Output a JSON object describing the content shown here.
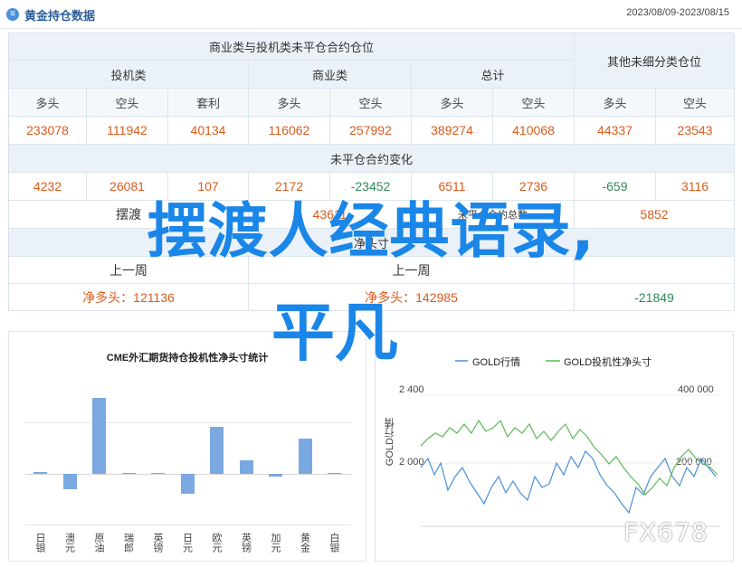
{
  "header": {
    "icon_glyph": "≡",
    "title": "黄金持仓数据",
    "date_range": "2023/08/09-2023/08/15"
  },
  "table": {
    "group_top": "商业类与投机类未平仓合约仓位",
    "group_right": "其他未细分类仓位",
    "group_spec": "投机类",
    "group_comm": "商业类",
    "group_total": "总计",
    "sub_headers": [
      "多头",
      "空头",
      "套利",
      "多头",
      "空头",
      "多头",
      "空头",
      "多头",
      "空头"
    ],
    "row1": [
      "233078",
      "111942",
      "40134",
      "116062",
      "257992",
      "389274",
      "410068",
      "44337",
      "23543"
    ],
    "section2": "未平仓合约变化",
    "row2": [
      "4232",
      "26081",
      "107",
      "2172",
      "-23452",
      "6511",
      "2736",
      "-659",
      "3116"
    ],
    "row3_label_left": "摆渡",
    "row3_value_mid": "43611",
    "row3_label_right": "未平仓合约总数",
    "row3_value_right": "5852",
    "row4_label": "净头寸",
    "row5_left": "上一周",
    "row5_mid": "上一周",
    "row6_left": "净多头：121136",
    "row6_mid": "净多头：142985",
    "row6_right": "-21849"
  },
  "overlay": {
    "line1": "摆渡人经典语录,",
    "line2": "平凡"
  },
  "chart_data": [
    {
      "type": "bar",
      "title": "CME外汇期货持仓投机性净头寸统计",
      "categories": [
        "日银",
        "澳元",
        "原油",
        "瑞郎",
        "英镑",
        "日元",
        "欧元",
        "英镑",
        "加元",
        "黄金",
        "白银"
      ],
      "values": [
        0.2,
        -1.5,
        7.5,
        0.1,
        0.1,
        -2.0,
        4.6,
        1.3,
        -0.3,
        3.5,
        0.1
      ],
      "grid": true
    },
    {
      "type": "line",
      "series": [
        {
          "name": "GOLD行情",
          "color": "#4a8fd8"
        },
        {
          "name": "GOLD投机性净头寸",
          "color": "#5cb85c"
        }
      ],
      "y_left_ticks": [
        "2 400",
        "2 000"
      ],
      "y_right_ticks": [
        "400 000",
        "200 000"
      ],
      "ylabel": "GOLD行情"
    }
  ],
  "watermark": "FX678"
}
